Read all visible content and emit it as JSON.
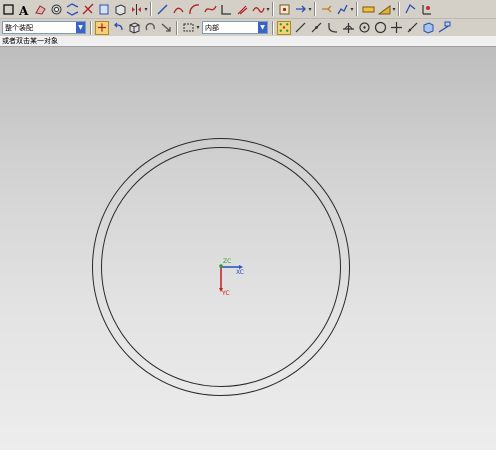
{
  "toolbar_row1": {
    "icons": [
      "sketch-rect-icon",
      "text-A-icon",
      "feature-icon",
      "hole-icon",
      "pattern-icon",
      "trim-icon",
      "sheet-icon",
      "box-icon",
      "mirror-icon",
      "sep",
      "line-icon",
      "arc-icon",
      "spline-icon",
      "corner-icon",
      "offset-icon",
      "sep",
      "point-icon",
      "move-icon",
      "sep",
      "measure-icon",
      "analysis-icon",
      "sep",
      "render-icon",
      "shade-icon",
      "sep",
      "view-icon"
    ]
  },
  "toolbar_row2": {
    "assembly_filter": {
      "value": "整个装配"
    },
    "selection_scope": {
      "value": "内部"
    }
  },
  "status": {
    "prompt": "或者双击某一对象"
  },
  "triad": {
    "x_label": "XC",
    "y_label": "YC",
    "z_label": "ZC"
  },
  "colors": {
    "axis_x": "#2050c8",
    "axis_y": "#c02020",
    "axis_z": "#30a030",
    "geometry": "#2a2a2a"
  }
}
